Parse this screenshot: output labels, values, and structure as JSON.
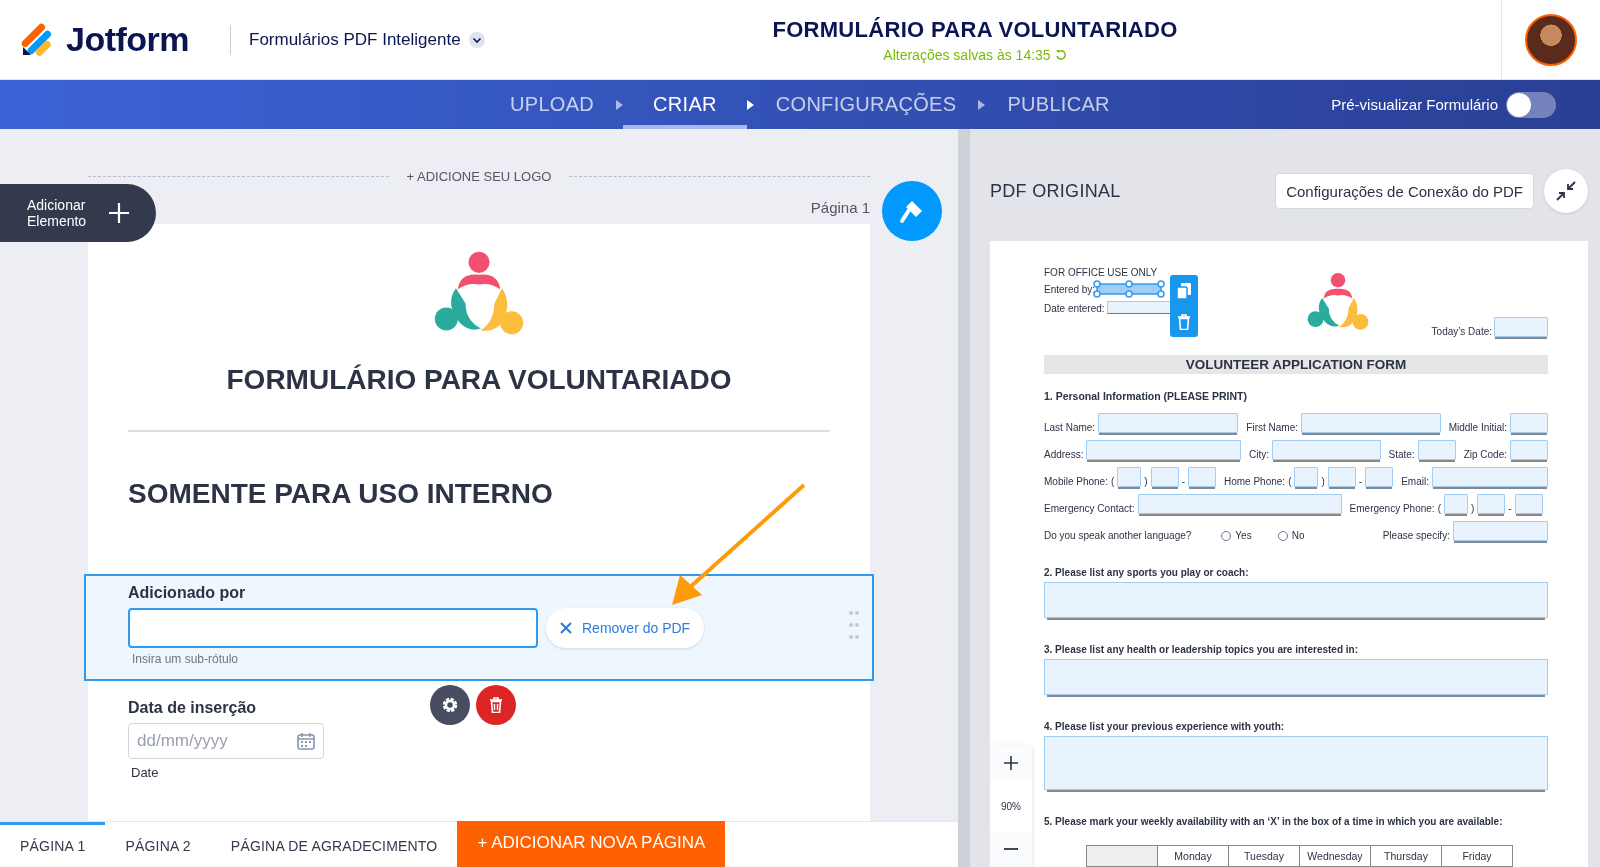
{
  "header": {
    "brand": "Jotform",
    "app_menu": "Formulários PDF Inteligente",
    "title": "FORMULÁRIO PARA VOLUNTARIADO",
    "saved_status": "Alterações salvas às 14:35"
  },
  "nav": {
    "steps": [
      {
        "label": "UPLOAD",
        "selected": false
      },
      {
        "label": "CRIAR",
        "selected": true
      },
      {
        "label": "CONFIGURAÇÕES",
        "selected": false
      },
      {
        "label": "PUBLICAR",
        "selected": false
      }
    ],
    "preview_toggle": {
      "label": "Pré-visualizar Formulário",
      "on": false
    }
  },
  "builder": {
    "add_element": "Adicionar Elemento",
    "add_logo": "+ ADICIONE SEU LOGO",
    "page_label": "Página 1",
    "form_title": "FORMULÁRIO PARA VOLUNTARIADO",
    "section_heading": "SOMENTE PARA USO INTERNO",
    "fields": [
      {
        "kind": "text",
        "label": "Adicionado por",
        "selected": true,
        "sublabel_placeholder": "Insira um sub-rótulo",
        "remove_button": "Remover do PDF"
      },
      {
        "kind": "date",
        "label": "Data de inserção",
        "selected": false,
        "placeholder": "dd/mm/yyyy",
        "sublabel": "Date"
      }
    ]
  },
  "page_tabs": [
    {
      "label": "PÁGINA 1",
      "selected": true
    },
    {
      "label": "PÁGINA 2",
      "selected": false
    },
    {
      "label": "PÁGINA DE AGRADECIMENTO",
      "selected": false
    }
  ],
  "add_page_button": "+ ADICIONAR NOVA PÁGINA",
  "pdf": {
    "heading": "PDF ORIGINAL",
    "connection_button": "Configurações de Conexão do PDF",
    "zoom_level": "90%",
    "document": {
      "office_heading": "FOR OFFICE USE ONLY",
      "office_fields": [
        {
          "label": "Entered by:",
          "selected": true
        },
        {
          "label": "Date entered:",
          "selected": false
        }
      ],
      "todays_date": "Today’s Date:",
      "title": "VOLUNTEER APPLICATION FORM",
      "section": "1. Personal Information (PLEASE PRINT)",
      "rows": [
        {
          "fields": [
            {
              "label": "Last Name:",
              "kind": "wide"
            },
            {
              "label": "First Name:",
              "kind": "wide"
            },
            {
              "label": "Middle Initial:",
              "kind": "narrow"
            }
          ]
        },
        {
          "fields": [
            {
              "label": "Address:",
              "kind": "wide"
            },
            {
              "label": "City:",
              "kind": "medium"
            },
            {
              "label": "State:",
              "kind": "narrow"
            },
            {
              "label": "Zip Code:",
              "kind": "narrow"
            }
          ]
        },
        {
          "fields": [
            {
              "label": "Mobile Phone:",
              "kind": "phone",
              "marks": [
                "(",
                ")",
                "-"
              ]
            },
            {
              "label": "Home Phone:",
              "kind": "phone",
              "marks": [
                "(",
                ")",
                "-"
              ]
            },
            {
              "label": "Email:",
              "kind": "medium"
            }
          ]
        },
        {
          "fields": [
            {
              "label": "Emergency Contact:",
              "kind": "wide"
            },
            {
              "label": "Emergency Phone:",
              "kind": "phone",
              "marks": [
                "(",
                ")",
                "-"
              ]
            }
          ]
        },
        {
          "fields": [
            {
              "label": "Do you speak another language?",
              "kind": "choice",
              "options": [
                {
                  "label": "Yes",
                  "checked": false
                },
                {
                  "label": "No",
                  "checked": false
                }
              ]
            },
            {
              "label": "Please specify:",
              "kind": "medium"
            }
          ]
        }
      ],
      "questions": [
        {
          "label": "2. Please list any sports you play or coach:",
          "kind": "short-answer"
        },
        {
          "label": "3. Please list any health or leadership topics you are interested in:",
          "kind": "short-answer"
        },
        {
          "label": "4. Please list your previous experience with youth:",
          "kind": "long-answer"
        },
        {
          "label": "5. Please mark your weekly availability with an ‘X’ in the box of a time in which you are available:",
          "kind": "table",
          "columns": [
            "Monday",
            "Tuesday",
            "Wednesday",
            "Thursday",
            "Friday"
          ]
        }
      ]
    }
  }
}
